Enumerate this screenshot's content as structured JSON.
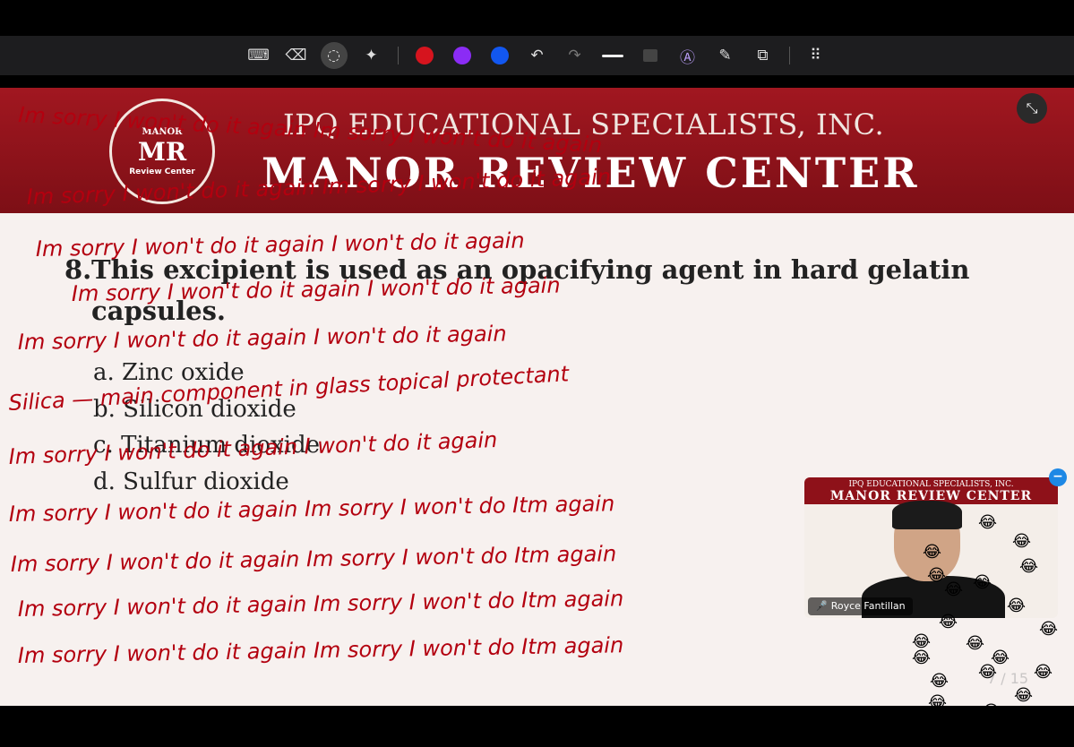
{
  "toolbar": {
    "keyboard_icon": "⌨",
    "eraser_icon": "⌫",
    "lasso_icon": "◌",
    "magic_icon": "✦",
    "undo_icon": "↶",
    "redo_icon": "↷",
    "highlighter_icon": "Ⓐ",
    "pen_icon": "✎",
    "share_icon": "⧉",
    "grid_icon": "⠿",
    "colors": [
      "#d6141e",
      "#8b2cf5",
      "#1257f0"
    ]
  },
  "slide": {
    "logo_top": "MANOR",
    "logo_mono": "MR",
    "logo_bottom": "Review Center",
    "banner_sub": "IPQ EDUCATIONAL SPECIALISTS, INC.",
    "banner_title": "MANOR REVIEW CENTER",
    "exit_fullscreen_icon": "⤡",
    "question_number": "8.",
    "question_text": "This excipient is used as an opacifying agent in hard gelatin capsules.",
    "choices": [
      "a. Zinc oxide",
      "b. Silicon dioxide",
      "c. Titanium dioxide",
      "d. Sulfur dioxide"
    ]
  },
  "video": {
    "banner_sub": "IPQ EDUCATIONAL SPECIALISTS, INC.",
    "banner_title": "MANOR REVIEW CENTER",
    "participant_name": "Royce Fantillan",
    "mic_icon": "🎤",
    "minimize_icon": "−"
  },
  "scribble_lines": [
    "Im sorry  I won't do it again  Im sorry  I won't do it again",
    "Im sorry  I won't do it again  Im sorry  I won't do it again",
    "Im sorry  I won't do it again  I won't do it again",
    "Im sorry  I won't do it again  I won't do it again",
    "Silica — main component in glass  topical protectant",
    "Im sorry  I won't do it again  I won't do it again",
    "Im sorry  I won't do it again  I won't do it again",
    "Im sorry  I won't do it again  Im sorry  I won't do Itm again",
    "Im sorry  I won't do it again  Im sorry  I won't do Itm again",
    "Im sorry  I won't do it again  Im sorry  I won't do Itm again",
    "Im sorry  I won't do it again  Im sorry  I won't do Itm again"
  ],
  "page_counter": "7 / 15",
  "emoji": "😂"
}
